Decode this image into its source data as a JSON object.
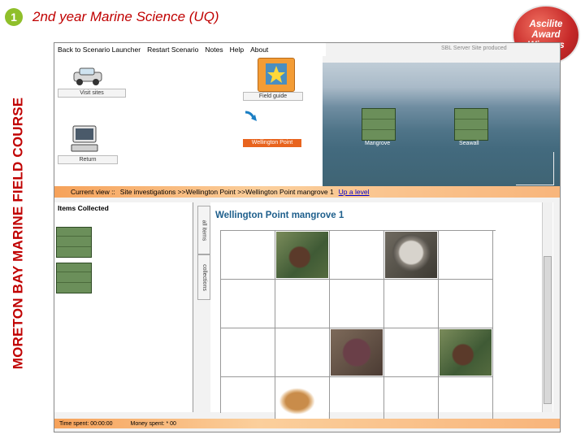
{
  "slide": {
    "number": "1",
    "title": "2nd year Marine Science (UQ)",
    "side_title": "MORETON BAY MARINE FIELD COURSE",
    "award": {
      "line1": "Ascilite",
      "line2": "Award",
      "line3": "Winners"
    }
  },
  "app": {
    "menu": [
      "Back to Scenario Launcher",
      "Restart Scenario",
      "Notes",
      "Help",
      "About"
    ],
    "credit": "SBL Server Site produced",
    "tools": {
      "visit_sites": "Visit sites",
      "return": "Return",
      "field_guide": "Field guide",
      "site_button": "Wellington Point"
    },
    "map_labels": [
      "Mangrove",
      "Seawall"
    ],
    "breadcrumb": {
      "prefix": "Current view ::",
      "path": "Site investigations   >>Wellington Point   >>Wellington Point mangrove 1",
      "up": "Up a level"
    },
    "items_title": "Items Collected",
    "vtabs": [
      "all items",
      "collections"
    ],
    "grid_title": "Wellington Point mangrove 1",
    "grid_cells": [
      "",
      "crab",
      "",
      "snail",
      "",
      "",
      "",
      "",
      "",
      "",
      "",
      "",
      "crab2",
      "",
      "crab",
      "",
      "shell",
      "",
      "",
      ""
    ],
    "status": {
      "time": "Time spent: 00:00:00",
      "money": "Money spent: * 00"
    },
    "colors": {
      "accent": "#c00000",
      "orange": "#f6a25a",
      "title_blue": "#1e5f8c",
      "link": "#0000cc"
    }
  }
}
